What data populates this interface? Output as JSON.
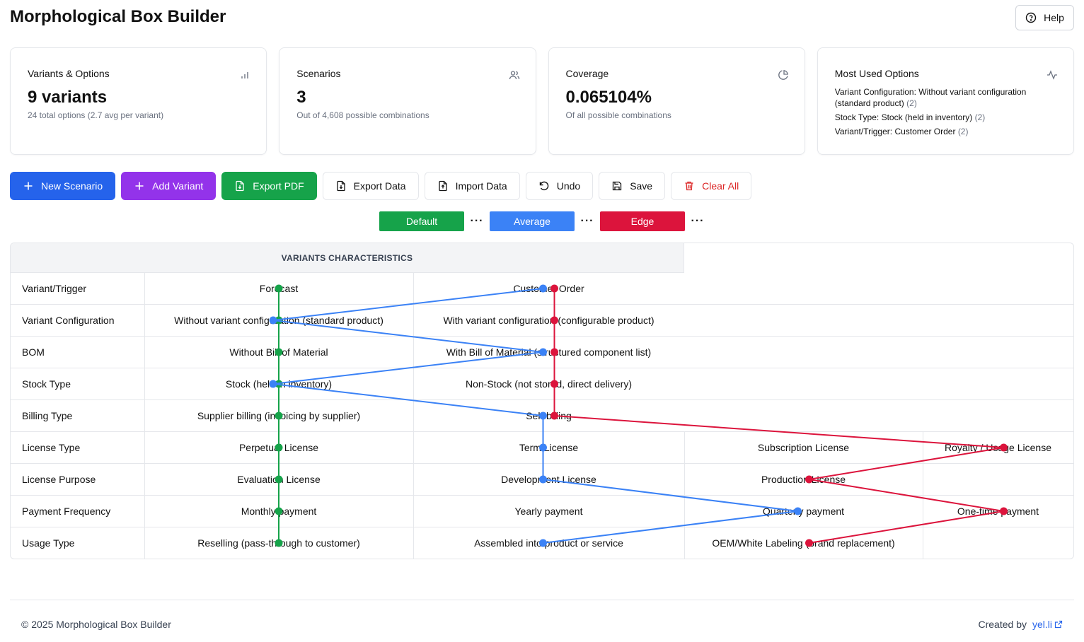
{
  "app": {
    "title": "Morphological Box Builder",
    "help_label": "Help"
  },
  "stats": {
    "variants": {
      "title": "Variants & Options",
      "value": "9 variants",
      "sub": "24 total options (2.7 avg per variant)"
    },
    "scenarios": {
      "title": "Scenarios",
      "value": "3",
      "sub": "Out of 4,608 possible combinations"
    },
    "coverage": {
      "title": "Coverage",
      "value": "0.065104%",
      "sub": "Of all possible combinations"
    },
    "most_used": {
      "title": "Most Used Options",
      "items": [
        {
          "text": "Variant Configuration: Without variant configuration (standard product)",
          "count": "(2)"
        },
        {
          "text": "Stock Type: Stock (held in inventory)",
          "count": "(2)"
        },
        {
          "text": "Variant/Trigger: Customer Order",
          "count": "(2)"
        }
      ]
    }
  },
  "toolbar": {
    "new_scenario": "New Scenario",
    "add_variant": "Add Variant",
    "export_pdf": "Export PDF",
    "export_data": "Export Data",
    "import_data": "Import Data",
    "undo": "Undo",
    "save": "Save",
    "clear_all": "Clear All"
  },
  "scenarios": [
    {
      "name": "Default",
      "color": "#16a34a",
      "more": "···"
    },
    {
      "name": "Average",
      "color": "#3b82f6",
      "more": "···"
    },
    {
      "name": "Edge",
      "color": "#dc143c",
      "more": "···"
    }
  ],
  "box": {
    "header": "VARIANTS CHARACTERISTICS",
    "rows": [
      {
        "label": "Variant/Trigger",
        "options": [
          "Forecast",
          "Customer Order"
        ]
      },
      {
        "label": "Variant Configuration",
        "options": [
          "Without variant configuration (standard product)",
          "With variant configuration (configurable product)"
        ]
      },
      {
        "label": "BOM",
        "options": [
          "Without Bill of Material",
          "With Bill of Material (structured component list)"
        ]
      },
      {
        "label": "Stock Type",
        "options": [
          "Stock (held in inventory)",
          "Non-Stock (not stored, direct delivery)"
        ]
      },
      {
        "label": "Billing Type",
        "options": [
          "Supplier billing (invoicing by supplier)",
          "Self-billing"
        ]
      },
      {
        "label": "License Type",
        "options": [
          "Perpetual License",
          "Term License",
          "Subscription License",
          "Royalty / Usage License"
        ]
      },
      {
        "label": "License Purpose",
        "options": [
          "Evaluation License",
          "Development License",
          "Production License"
        ]
      },
      {
        "label": "Payment Frequency",
        "options": [
          "Monthly payment",
          "Yearly payment",
          "Quarterly payment",
          "One-time payment"
        ]
      },
      {
        "label": "Usage Type",
        "options": [
          "Reselling (pass-through to customer)",
          "Assembled into product or service",
          "OEM/White Labeling (brand replacement)"
        ]
      }
    ],
    "paths": [
      {
        "scenario": "Default",
        "color": "#16a34a",
        "selections": [
          0,
          0,
          0,
          0,
          0,
          0,
          0,
          0,
          0
        ]
      },
      {
        "scenario": "Average",
        "color": "#3b82f6",
        "selections": [
          1,
          0,
          1,
          0,
          1,
          1,
          1,
          2,
          1
        ]
      },
      {
        "scenario": "Edge",
        "color": "#dc143c",
        "selections": [
          1,
          1,
          1,
          1,
          1,
          3,
          2,
          3,
          2
        ]
      }
    ]
  },
  "footer": {
    "copyright": "© 2025 Morphological Box Builder",
    "created_by": "Created by",
    "link": "yel.li"
  }
}
